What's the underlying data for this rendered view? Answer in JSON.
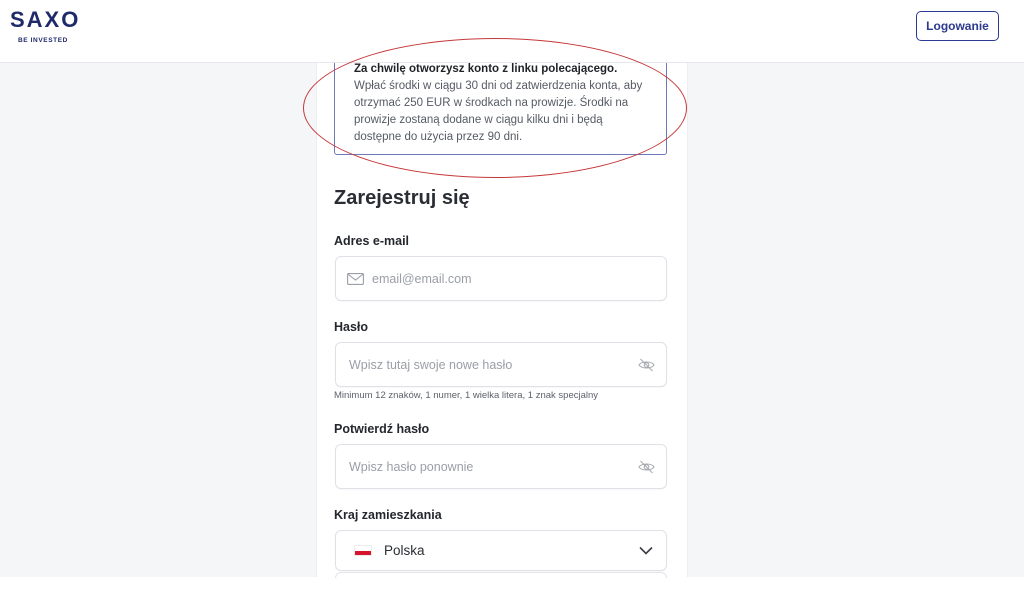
{
  "header": {
    "logo_main": "SAXO",
    "logo_sub": "BE INVESTED",
    "login_label": "Logowanie"
  },
  "referral": {
    "title": "Za chwilę otworzysz konto z linku polecającego.",
    "body": "Wpłać środki w ciągu 30 dni od zatwierdzenia konta, aby otrzymać 250 EUR w środkach na prowizje. Środki na prowizje zostaną dodane w ciągu kilku dni i będą dostępne do użycia przez 90 dni."
  },
  "form": {
    "title": "Zarejestruj się",
    "email": {
      "label": "Adres e-mail",
      "placeholder": "email@email.com",
      "icon": "mail-icon"
    },
    "password": {
      "label": "Hasło",
      "placeholder": "Wpisz tutaj swoje nowe hasło",
      "hint": "Minimum 12 znaków, 1 numer, 1 wielka litera, 1 znak specjalny",
      "icon": "eye-off-icon"
    },
    "confirm_password": {
      "label": "Potwierdź hasło",
      "placeholder": "Wpisz hasło ponownie",
      "icon": "eye-off-icon"
    },
    "country": {
      "label": "Kraj zamieszkania",
      "selected": "Polska",
      "flag": "poland-flag-icon",
      "icon": "chevron-down-icon"
    }
  },
  "colors": {
    "brand": "#1f2a6b",
    "accent": "#2b3a8f",
    "annotation": "#c6383a",
    "page_background": "#f5f6f8"
  }
}
